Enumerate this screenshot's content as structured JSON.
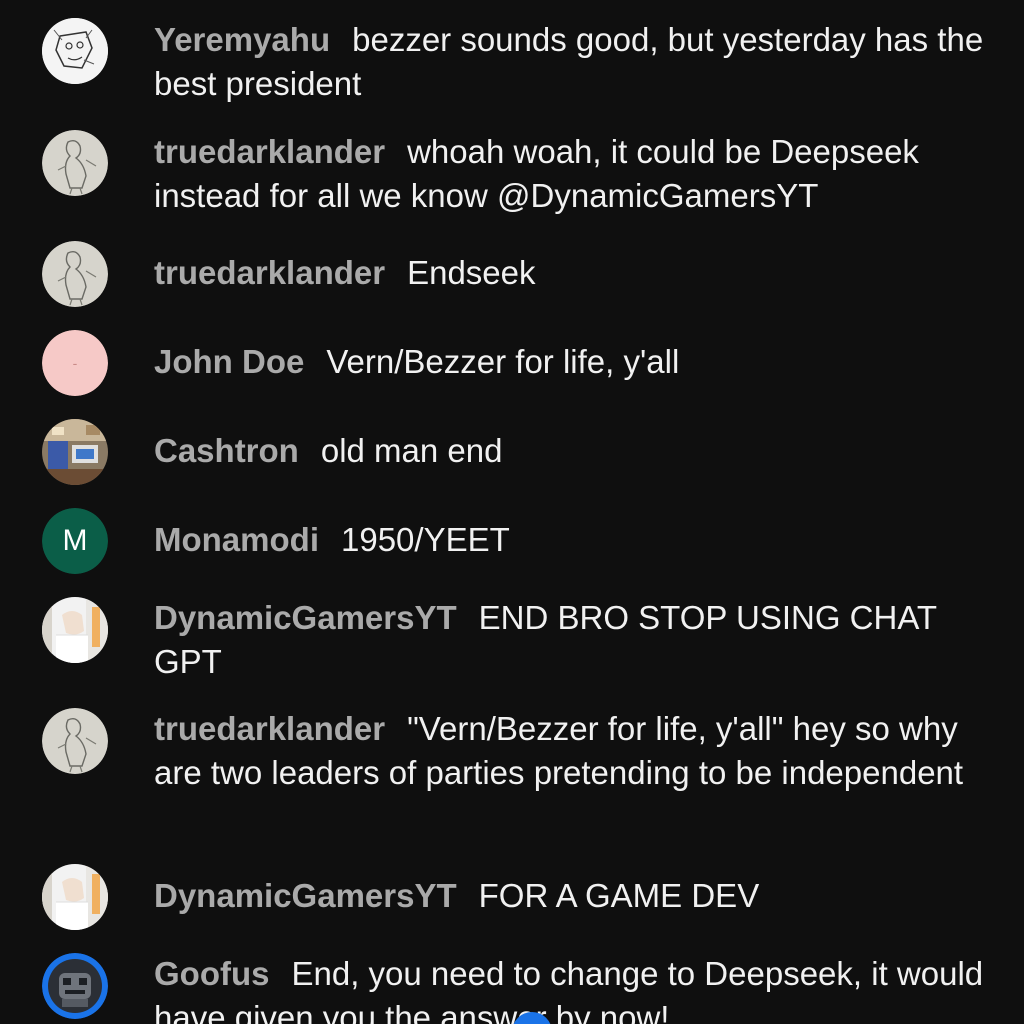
{
  "messages": [
    {
      "author": "Yeremyahu",
      "text": "bezzer sounds good, but yesterday has the best president",
      "avatar_icon": "sketch-face-avatar-icon"
    },
    {
      "author": "truedarklander",
      "text": "whoah woah, it could be Deepseek instead for all we know @DynamicGamersYT",
      "avatar_icon": "sketch-figure-avatar-icon"
    },
    {
      "author": "truedarklander",
      "text": "Endseek",
      "avatar_icon": "sketch-figure-avatar-icon"
    },
    {
      "author": "John Doe",
      "text": "Vern/Bezzer for life, y'all",
      "avatar_icon": "pink-blank-avatar-icon"
    },
    {
      "author": "Cashtron",
      "text": "old man end",
      "avatar_icon": "photo-avatar-icon"
    },
    {
      "author": "Monamodi",
      "text": "1950/YEET",
      "avatar_letter": "M",
      "avatar_color": "#0b5e48"
    },
    {
      "author": "DynamicGamersYT",
      "text": "END BRO STOP USING CHAT GPT",
      "avatar_icon": "person-photo-avatar-icon"
    },
    {
      "author": "truedarklander",
      "text": "\"Vern/Bezzer for life, y'all\" hey so why are two leaders of parties pretending to be independent",
      "avatar_icon": "sketch-figure-avatar-icon"
    },
    {
      "author": "DynamicGamersYT",
      "text": "FOR A GAME DEV",
      "avatar_icon": "person-photo-avatar-icon"
    },
    {
      "author": "Goofus",
      "text": "End, you need to change to Deepseek, it would have given you the answer by now!",
      "avatar_icon": "robot-avatar-icon"
    }
  ],
  "colors": {
    "background": "#0f0f0f",
    "author": "#aaaaaa",
    "message": "#f1f1f1",
    "accent": "#1a73e8"
  }
}
